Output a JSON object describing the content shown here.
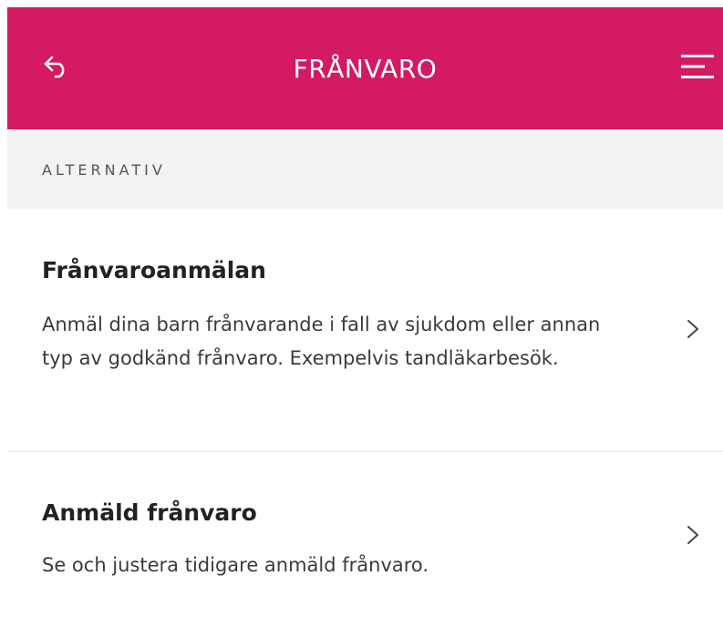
{
  "header": {
    "title": "FRÅNVARO",
    "back_icon": "back-arrow-icon",
    "menu_icon": "hamburger-menu-icon",
    "background_color": "#d31a62"
  },
  "section": {
    "label": "ALTERNATIV"
  },
  "items": [
    {
      "title": "Frånvaroanmälan",
      "description": "Anmäl dina barn frånvarande i fall av sjukdom eller annan typ av godkänd frånvaro. Exempelvis tandläkarbesök.",
      "icon": "chevron-right-icon"
    },
    {
      "title": "Anmäld frånvaro",
      "description": "Se och justera tidigare anmäld frånvaro.",
      "icon": "chevron-right-icon"
    }
  ]
}
